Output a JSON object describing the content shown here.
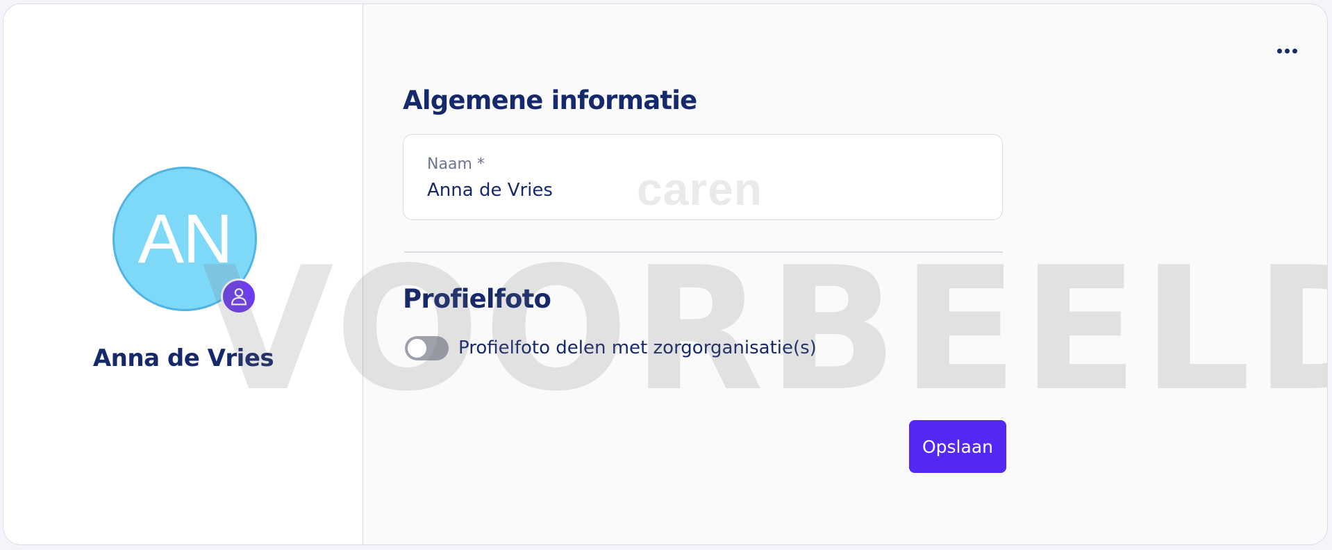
{
  "profile": {
    "initials": "AN",
    "name": "Anna de Vries",
    "avatar_color": "#7ed8f8",
    "badge_icon": "user-icon"
  },
  "watermark": {
    "text": "VOORBEELD"
  },
  "menu": {
    "more_icon": "more-horizontal-icon"
  },
  "general_info": {
    "title": "Algemene informatie",
    "name_field": {
      "label": "Naam *",
      "value": "Anna de Vries",
      "brand_watermark": "caren"
    }
  },
  "profile_photo": {
    "title": "Profielfoto",
    "share_toggle": {
      "label": "Profielfoto delen met zorgorganisatie(s)",
      "enabled": false
    }
  },
  "actions": {
    "save_label": "Opslaan",
    "save_color": "#5527f2"
  }
}
